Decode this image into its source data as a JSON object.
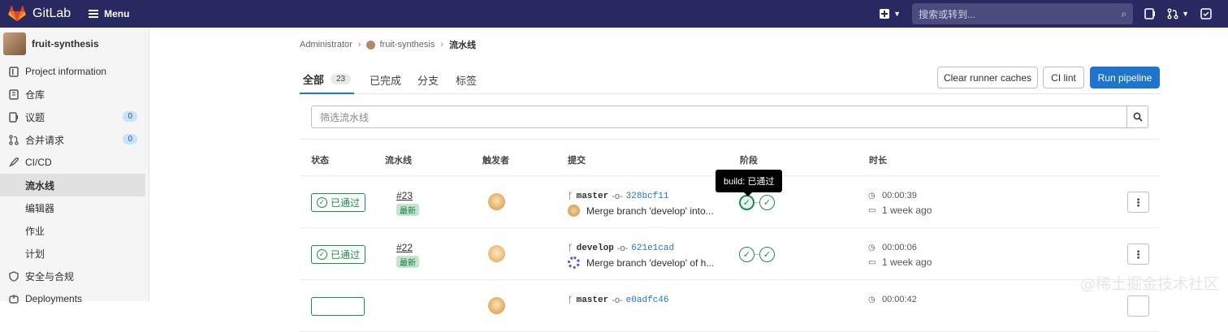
{
  "topbar": {
    "brand": "GitLab",
    "menu_label": "Menu",
    "search_placeholder": "搜索或转到..."
  },
  "sidebar": {
    "project_name": "fruit-synthesis",
    "items": [
      {
        "label": "Project information",
        "icon": "info-doc-icon"
      },
      {
        "label": "仓库",
        "icon": "doc-icon"
      },
      {
        "label": "议题",
        "icon": "issues-icon",
        "count": "0"
      },
      {
        "label": "合并请求",
        "icon": "merge-request-icon",
        "count": "0"
      },
      {
        "label": "CI/CD",
        "icon": "rocket-icon"
      },
      {
        "label": "流水线",
        "active": true
      },
      {
        "label": "编辑器"
      },
      {
        "label": "作业"
      },
      {
        "label": "计划"
      },
      {
        "label": "安全与合规",
        "icon": "shield-icon"
      },
      {
        "label": "Deployments",
        "icon": "deploy-icon"
      }
    ]
  },
  "breadcrumb": {
    "root": "Administrator",
    "project": "fruit-synthesis",
    "current": "流水线"
  },
  "tabs": [
    {
      "label": "全部",
      "badge": "23"
    },
    {
      "label": "已完成"
    },
    {
      "label": "分支"
    },
    {
      "label": "标签"
    }
  ],
  "buttons": {
    "clear_cache": "Clear runner caches",
    "ci_lint": "CI lint",
    "run_pipeline": "Run pipeline"
  },
  "filter": {
    "placeholder": "筛选流水线"
  },
  "table": {
    "headers": [
      "状态",
      "流水线",
      "触发者",
      "提交",
      "阶段",
      "时长"
    ],
    "rows": [
      {
        "status": "已通过",
        "id": "#23",
        "tag": "最新",
        "branch": "master",
        "sha": "328bcf11",
        "message": "Merge branch 'develop' into...",
        "duration": "00:00:39",
        "finished": "1 week ago"
      },
      {
        "status": "已通过",
        "id": "#22",
        "tag": "最新",
        "branch": "develop",
        "sha": "621e1cad",
        "message": "Merge branch 'develop' of h...",
        "duration": "00:00:06",
        "finished": "1 week ago"
      },
      {
        "status": "",
        "id": "",
        "tag": "",
        "branch": "master",
        "sha": "e0adfc46",
        "message": "",
        "duration": "00:00:42",
        "finished": ""
      }
    ]
  },
  "tooltip": "build: 已通过",
  "watermark": "@稀土掘金技术社区",
  "colors": {
    "topbar": "#292961",
    "primary": "#1f75cb",
    "success": "#1f8a4a"
  }
}
